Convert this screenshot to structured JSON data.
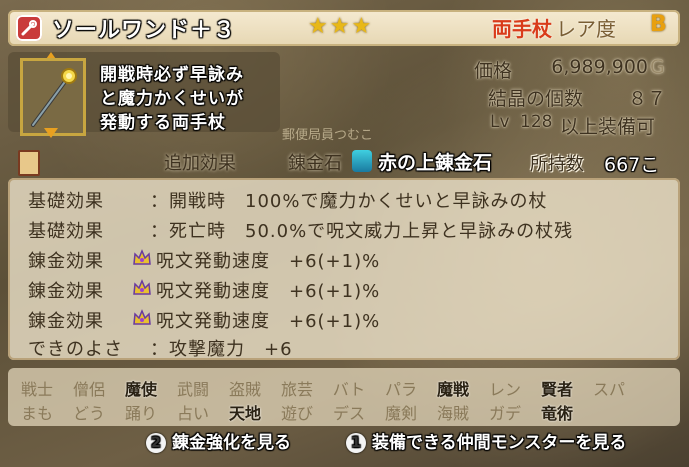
{
  "header": {
    "item_name": "ソールワンド＋３",
    "stars": "★★★",
    "weapon_type": "両手杖",
    "rarity_label": "レア度",
    "rarity_value": "B"
  },
  "description": {
    "lines": [
      "開戦時必ず早詠み",
      "と魔力かくせいが",
      "発動する両手杖"
    ]
  },
  "stats": {
    "price_label": "価格",
    "price_value": "6,989,900",
    "price_unit": "G",
    "crystal_label": "結晶の個数",
    "crystal_value": "８７",
    "level_prefix": "Lv",
    "level_value": "128",
    "level_suffix": "以上装備可"
  },
  "watermark_text": "郵便局員つむこ",
  "alchemy_row": {
    "extra_effect_label": "追加効果",
    "stone_label": "錬金石",
    "stone_name": "赤の上錬金石",
    "owned_label": "所持数",
    "owned_value": "667こ"
  },
  "effects": [
    {
      "label": "基礎効果",
      "text": "：開戦時　100%で魔力かくせいと早詠みの杖"
    },
    {
      "label": "基礎効果",
      "text": "：死亡時　50.0%で呪文威力上昇と早詠みの杖残"
    },
    {
      "label": "錬金効果",
      "text": "呪文発動速度　+6(+1)%"
    },
    {
      "label": "錬金効果",
      "text": "呪文発動速度　+6(+1)%"
    },
    {
      "label": "錬金効果",
      "text": "呪文発動速度　+6(+1)%"
    },
    {
      "label": "できのよさ",
      "text": "：攻撃魔力　+6"
    }
  ],
  "jobs_row1": [
    "戦士",
    "僧侶",
    "魔使",
    "武闘",
    "盗賊",
    "旅芸",
    "バト",
    "パラ",
    "魔戦",
    "レン",
    "賢者",
    "スパ"
  ],
  "jobs_row2": [
    "まも",
    "どう",
    "踊り",
    "占い",
    "天地",
    "遊び",
    "デス",
    "魔剣",
    "海賊",
    "ガデ",
    "竜術"
  ],
  "footer": {
    "btn2_num": "2",
    "btn2_label": "錬金強化を見る",
    "btn1_num": "1",
    "btn1_label": "装備できる仲間モンスターを見る"
  },
  "colors": {
    "accent_red": "#d93b1a",
    "star_gold": "#e8b818",
    "rarity_gold": "#e8a010"
  }
}
